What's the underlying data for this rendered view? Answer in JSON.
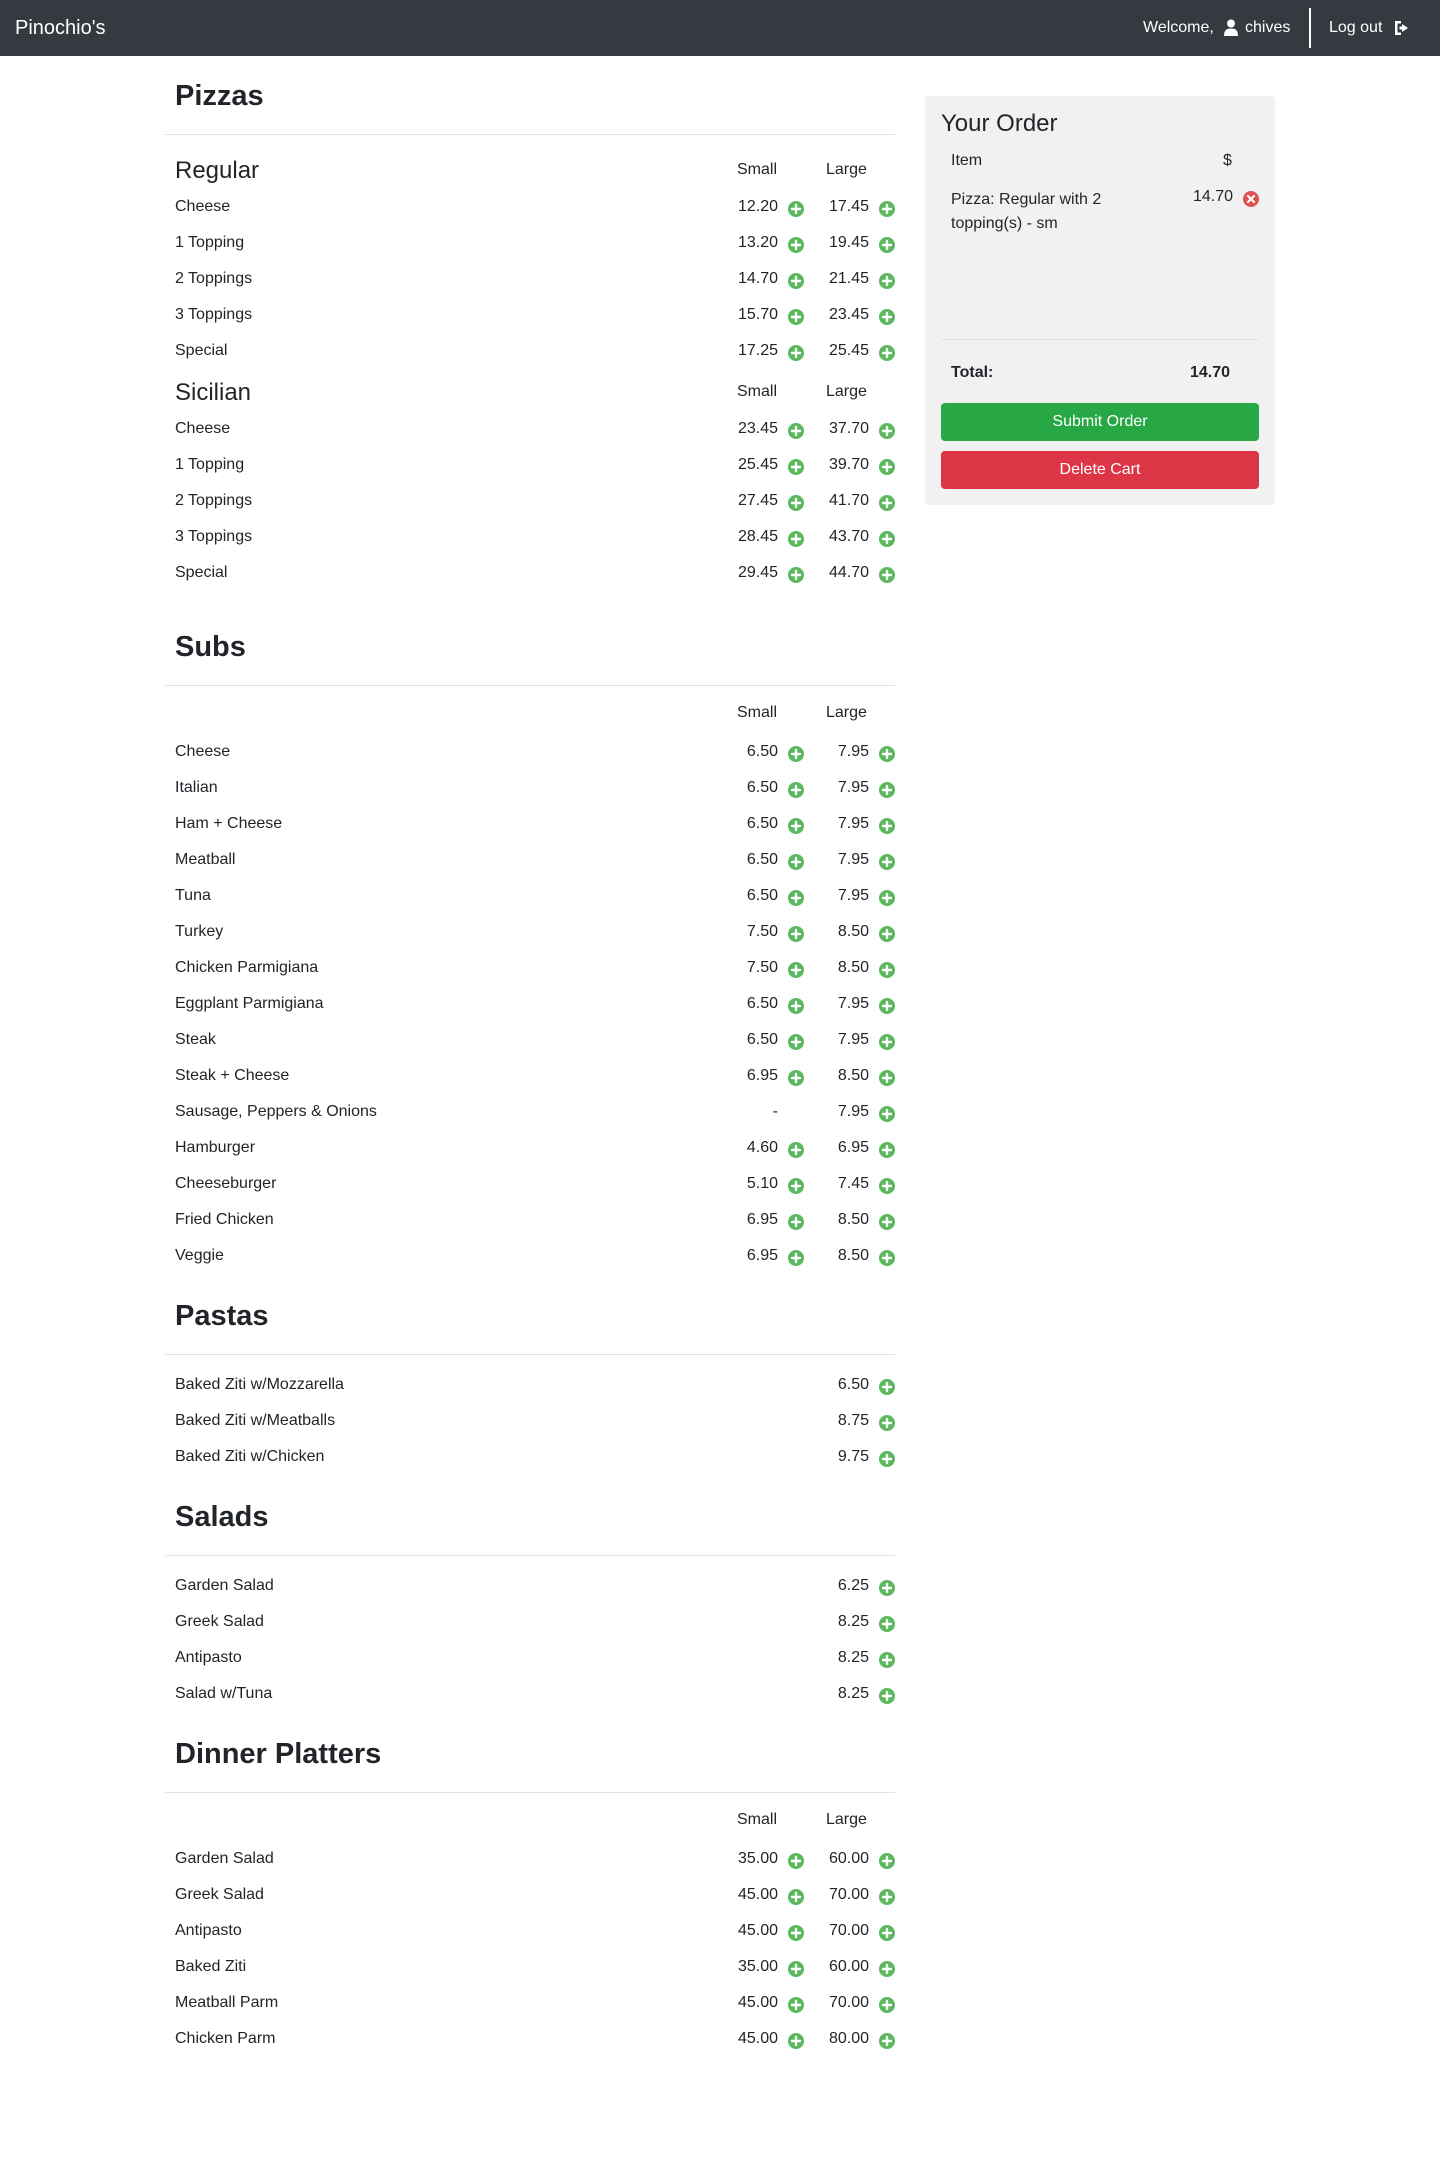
{
  "navbar": {
    "brand": "Pinochio's",
    "welcome": "Welcome,",
    "username": "chives",
    "logout": "Log out"
  },
  "colors": {
    "navbar_bg": "#343a40",
    "add_green": "#5cb85c",
    "remove_red": "#e05252",
    "submit_green": "#28a745",
    "delete_red": "#dc3545",
    "panel_bg": "#f1f1f1"
  },
  "menu": {
    "pizzas": {
      "title": "Pizzas",
      "regular": {
        "title": "Regular",
        "small_label": "Small",
        "large_label": "Large",
        "items": [
          {
            "name": "Cheese",
            "small": "12.20",
            "large": "17.45"
          },
          {
            "name": "1 Topping",
            "small": "13.20",
            "large": "19.45"
          },
          {
            "name": "2 Toppings",
            "small": "14.70",
            "large": "21.45"
          },
          {
            "name": "3 Toppings",
            "small": "15.70",
            "large": "23.45"
          },
          {
            "name": "Special",
            "small": "17.25",
            "large": "25.45"
          }
        ]
      },
      "sicilian": {
        "title": "Sicilian",
        "small_label": "Small",
        "large_label": "Large",
        "items": [
          {
            "name": "Cheese",
            "small": "23.45",
            "large": "37.70"
          },
          {
            "name": "1 Topping",
            "small": "25.45",
            "large": "39.70"
          },
          {
            "name": "2 Toppings",
            "small": "27.45",
            "large": "41.70"
          },
          {
            "name": "3 Toppings",
            "small": "28.45",
            "large": "43.70"
          },
          {
            "name": "Special",
            "small": "29.45",
            "large": "44.70"
          }
        ]
      }
    },
    "subs": {
      "title": "Subs",
      "small_label": "Small",
      "large_label": "Large",
      "items": [
        {
          "name": "Cheese",
          "small": "6.50",
          "large": "7.95"
        },
        {
          "name": "Italian",
          "small": "6.50",
          "large": "7.95"
        },
        {
          "name": "Ham + Cheese",
          "small": "6.50",
          "large": "7.95"
        },
        {
          "name": "Meatball",
          "small": "6.50",
          "large": "7.95"
        },
        {
          "name": "Tuna",
          "small": "6.50",
          "large": "7.95"
        },
        {
          "name": "Turkey",
          "small": "7.50",
          "large": "8.50"
        },
        {
          "name": "Chicken Parmigiana",
          "small": "7.50",
          "large": "8.50"
        },
        {
          "name": "Eggplant Parmigiana",
          "small": "6.50",
          "large": "7.95"
        },
        {
          "name": "Steak",
          "small": "6.50",
          "large": "7.95"
        },
        {
          "name": "Steak + Cheese",
          "small": "6.95",
          "large": "8.50"
        },
        {
          "name": "Sausage, Peppers & Onions",
          "small": "-",
          "large": "7.95"
        },
        {
          "name": "Hamburger",
          "small": "4.60",
          "large": "6.95"
        },
        {
          "name": "Cheeseburger",
          "small": "5.10",
          "large": "7.45"
        },
        {
          "name": "Fried Chicken",
          "small": "6.95",
          "large": "8.50"
        },
        {
          "name": "Veggie",
          "small": "6.95",
          "large": "8.50"
        }
      ]
    },
    "pastas": {
      "title": "Pastas",
      "items": [
        {
          "name": "Baked Ziti w/Mozzarella",
          "price": "6.50"
        },
        {
          "name": "Baked Ziti w/Meatballs",
          "price": "8.75"
        },
        {
          "name": "Baked Ziti w/Chicken",
          "price": "9.75"
        }
      ]
    },
    "salads": {
      "title": "Salads",
      "items": [
        {
          "name": "Garden Salad",
          "price": "6.25"
        },
        {
          "name": "Greek Salad",
          "price": "8.25"
        },
        {
          "name": "Antipasto",
          "price": "8.25"
        },
        {
          "name": "Salad w/Tuna",
          "price": "8.25"
        }
      ]
    },
    "platters": {
      "title": "Dinner Platters",
      "small_label": "Small",
      "large_label": "Large",
      "items": [
        {
          "name": "Garden Salad",
          "small": "35.00",
          "large": "60.00"
        },
        {
          "name": "Greek Salad",
          "small": "45.00",
          "large": "70.00"
        },
        {
          "name": "Antipasto",
          "small": "45.00",
          "large": "70.00"
        },
        {
          "name": "Baked Ziti",
          "small": "35.00",
          "large": "60.00"
        },
        {
          "name": "Meatball Parm",
          "small": "45.00",
          "large": "70.00"
        },
        {
          "name": "Chicken Parm",
          "small": "45.00",
          "large": "80.00"
        }
      ]
    }
  },
  "order": {
    "title": "Your Order",
    "col_item": "Item",
    "col_price": "$",
    "lines": [
      {
        "text": "Pizza: Regular with 2 topping(s) - sm",
        "price": "14.70"
      }
    ],
    "total_label": "Total:",
    "total_value": "14.70",
    "submit_label": "Submit Order",
    "delete_label": "Delete Cart"
  }
}
